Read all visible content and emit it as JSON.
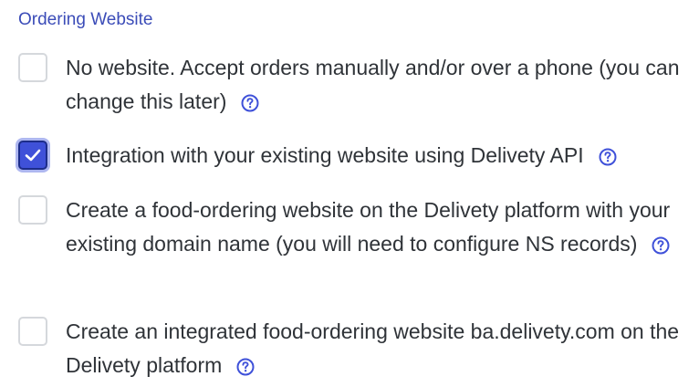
{
  "section": {
    "title": "Ordering Website"
  },
  "options": [
    {
      "label": "No website. Accept orders manually and/or over a phone (you can change this later)",
      "checked": false,
      "icon": "help-circle-icon"
    },
    {
      "label": "Integration with your existing website using Delivety API",
      "checked": true,
      "icon": "help-circle-icon"
    },
    {
      "label": "Create a food-ordering website on the Delivety platform with your existing domain name (you will need to configure NS records)",
      "checked": false,
      "icon": "help-circle-icon"
    },
    {
      "label": "Create an integrated food-ordering website ba.delivety.com on the Delivety platform",
      "checked": false,
      "icon": "help-circle-icon"
    }
  ],
  "colors": {
    "accent": "#3f51d9",
    "title": "#3b4cb8",
    "text": "#2f3338",
    "checkbox_border": "#d5d8dc"
  }
}
